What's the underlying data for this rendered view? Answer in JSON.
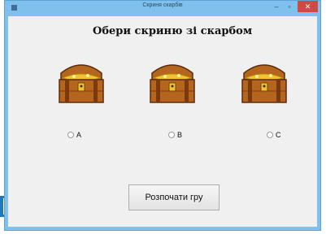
{
  "window": {
    "title": "Скриня скарбів",
    "minimize_label": "–",
    "maximize_label": "▫",
    "close_label": "✕"
  },
  "main": {
    "heading": "Обери скриню зі скарбом",
    "chests": [
      {
        "icon": "treasure-chest-icon"
      },
      {
        "icon": "treasure-chest-icon"
      },
      {
        "icon": "treasure-chest-icon"
      }
    ],
    "options": [
      {
        "label": "A",
        "selected": false
      },
      {
        "label": "B",
        "selected": false
      },
      {
        "label": "C",
        "selected": false
      }
    ],
    "start_button": "Розпочати гру"
  },
  "colors": {
    "window_frame": "#7fc0ec",
    "client_bg": "#f0f0f0",
    "close_button": "#cf4a45",
    "chest_wood": "#b5651d",
    "chest_gold": "#f2c232"
  }
}
